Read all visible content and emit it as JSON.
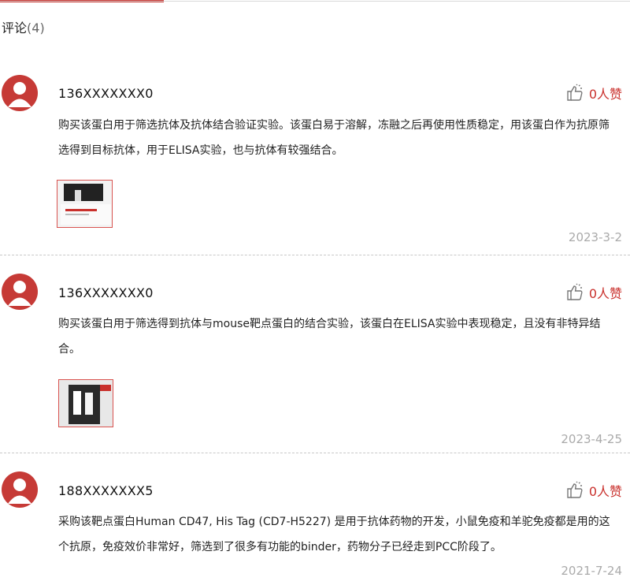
{
  "section": {
    "title": "评论",
    "count": "(4)"
  },
  "reviews": [
    {
      "user": "136XXXXXXX0",
      "likes": "0人赞",
      "text": "购买该蛋白用于筛选抗体及抗体结合验证实验。该蛋白易于溶解，冻融之后再使用性质稳定，用该蛋白作为抗原筛选得到目标抗体，用于ELISA实验，也与抗体有较强结合。",
      "date": "2023-3-2"
    },
    {
      "user": "136XXXXXXX0",
      "likes": "0人赞",
      "text": "购买该蛋白用于筛选得到抗体与mouse靶点蛋白的结合实验，该蛋白在ELISA实验中表现稳定，且没有非特异结合。",
      "date": "2023-4-25"
    },
    {
      "user": "188XXXXXXX5",
      "likes": "0人赞",
      "text": "采购该靶点蛋白Human CD47, His Tag (CD7-H5227) 是用于抗体药物的开发，小鼠免疫和羊驼免疫都是用的这个抗原，免疫效价非常好，筛选到了很多有功能的binder，药物分子已经走到PCC阶段了。",
      "date": "2021-7-24"
    }
  ],
  "colors": {
    "accent": "#c9302c",
    "avatar": "#c63a36",
    "date": "#aaaaaa"
  },
  "icons": {
    "avatar": "user-silhouette-icon",
    "like": "thumbs-up-icon"
  }
}
